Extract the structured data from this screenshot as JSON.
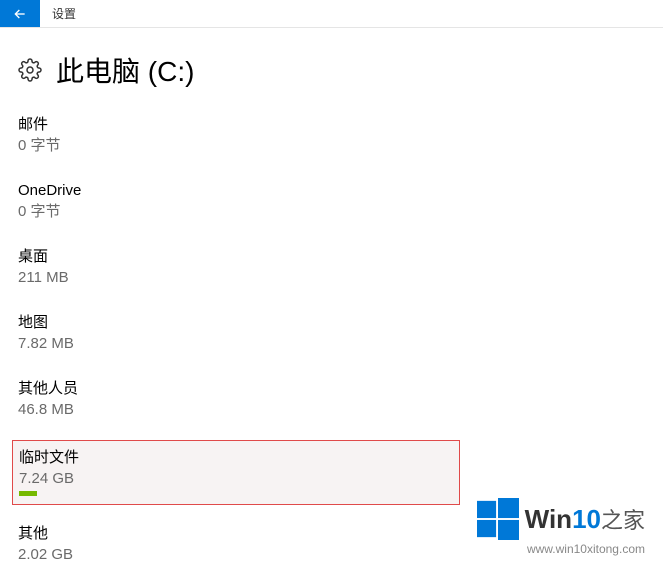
{
  "topbar": {
    "title": "设置"
  },
  "header": {
    "title": "此电脑 (C:)"
  },
  "storage": {
    "items": [
      {
        "label": "邮件",
        "size": "0 字节"
      },
      {
        "label": "OneDrive",
        "size": "0 字节"
      },
      {
        "label": "桌面",
        "size": "211 MB"
      },
      {
        "label": "地图",
        "size": "7.82 MB"
      },
      {
        "label": "其他人员",
        "size": "46.8 MB"
      },
      {
        "label": "临时文件",
        "size": "7.24 GB"
      },
      {
        "label": "其他",
        "size": "2.02 GB"
      }
    ]
  },
  "watermark": {
    "brand_prefix": "Win",
    "brand_accent": "10",
    "brand_suffix": "之家",
    "url": "www.win10xitong.com"
  }
}
